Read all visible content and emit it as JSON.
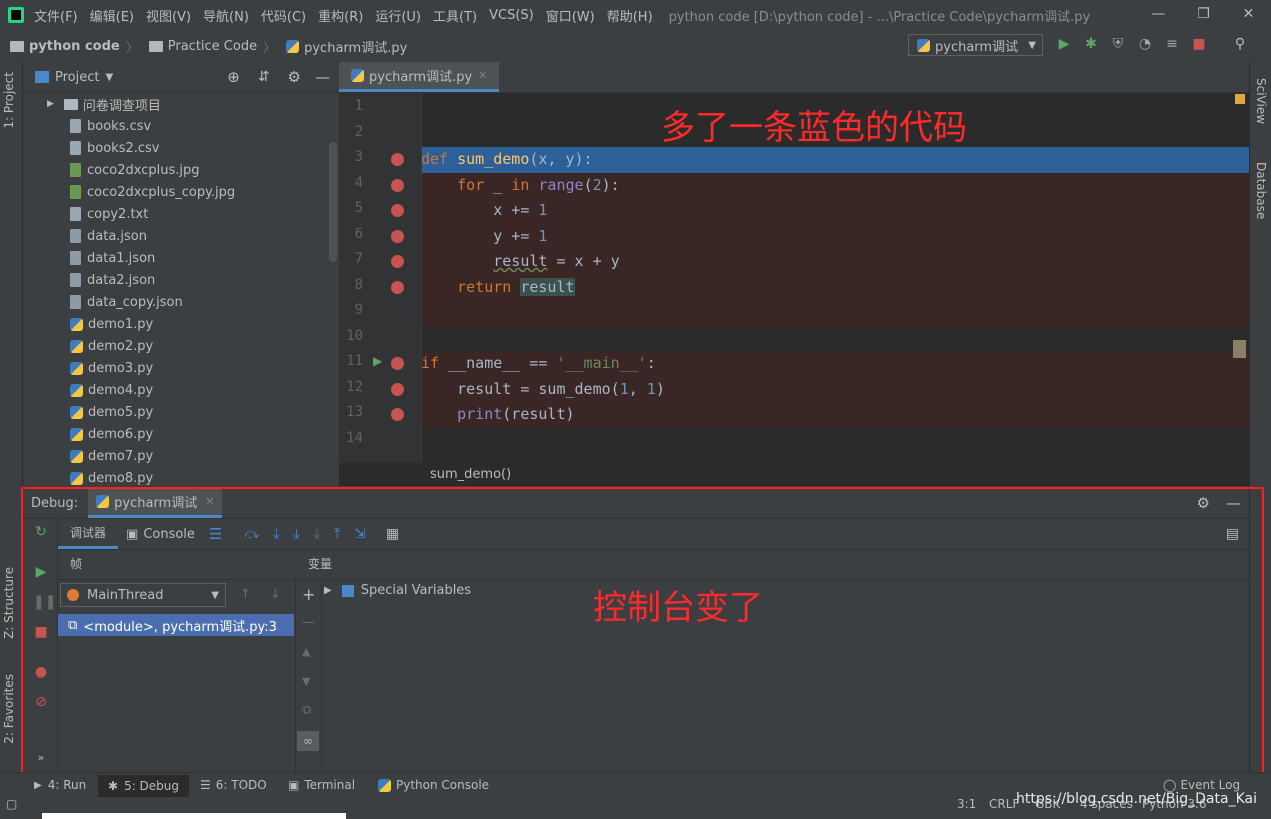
{
  "menu": {
    "items": [
      "文件(F)",
      "编辑(E)",
      "视图(V)",
      "导航(N)",
      "代码(C)",
      "重构(R)",
      "运行(U)",
      "工具(T)",
      "VCS(S)",
      "窗口(W)",
      "帮助(H)"
    ],
    "window_title": "python code [D:\\python code] - ...\\Practice Code\\pycharm调试.py"
  },
  "breadcrumb": {
    "root": "python code",
    "folder": "Practice Code",
    "file": "pycharm调试.py"
  },
  "run_config": "pycharm调试",
  "left_strip": {
    "project": "1: Project",
    "structure": "Z: Structure",
    "favorites": "2: Favorites"
  },
  "right_strip": {
    "sciview": "SciView",
    "database": "Database"
  },
  "project_panel": {
    "title": "Project",
    "tree": [
      {
        "name": "问卷调查项目",
        "type": "folder"
      },
      {
        "name": "books.csv",
        "type": "file"
      },
      {
        "name": "books2.csv",
        "type": "file"
      },
      {
        "name": "coco2dxcplus.jpg",
        "type": "image"
      },
      {
        "name": "coco2dxcplus_copy.jpg",
        "type": "image"
      },
      {
        "name": "copy2.txt",
        "type": "file"
      },
      {
        "name": "data.json",
        "type": "json"
      },
      {
        "name": "data1.json",
        "type": "json"
      },
      {
        "name": "data2.json",
        "type": "json"
      },
      {
        "name": "data_copy.json",
        "type": "json"
      },
      {
        "name": "demo1.py",
        "type": "py"
      },
      {
        "name": "demo2.py",
        "type": "py"
      },
      {
        "name": "demo3.py",
        "type": "py"
      },
      {
        "name": "demo4.py",
        "type": "py"
      },
      {
        "name": "demo5.py",
        "type": "py"
      },
      {
        "name": "demo6.py",
        "type": "py"
      },
      {
        "name": "demo7.py",
        "type": "py"
      },
      {
        "name": "demo8.py",
        "type": "py"
      }
    ]
  },
  "editor": {
    "tab": "pycharm调试.py",
    "line_numbers": [
      "1",
      "2",
      "3",
      "4",
      "5",
      "6",
      "7",
      "8",
      "9",
      "10",
      "11",
      "12",
      "13",
      "14"
    ],
    "breadcrumb_fn": "sum_demo()",
    "annotation": "多了一条蓝色的代码"
  },
  "debug": {
    "label": "Debug:",
    "tab": "pycharm调试",
    "debugger_tab": "调试器",
    "console_tab": "Console",
    "frames_label": "帧",
    "vars_label": "变量",
    "thread": "MainThread",
    "frame": "<module>, pycharm调试.py:3",
    "special_vars": "Special Variables",
    "annotation": "控制台变了"
  },
  "statusbar": {
    "tabs": [
      "4: Run",
      "5: Debug",
      "6: TODO",
      "Terminal",
      "Python Console"
    ],
    "event_log": "Event Log",
    "position": "3:1",
    "line_sep": "CRLF",
    "encoding": "GBK",
    "indent": "4 spaces",
    "interpreter": "Python 3.6",
    "watermark": "https://blog.csdn.net/Big_Data_Kai"
  },
  "colors": {
    "accent": "#4a88c7",
    "breakpoint": "#c75450",
    "current_line": "#2d6099",
    "annotation": "#ff2a2a"
  }
}
